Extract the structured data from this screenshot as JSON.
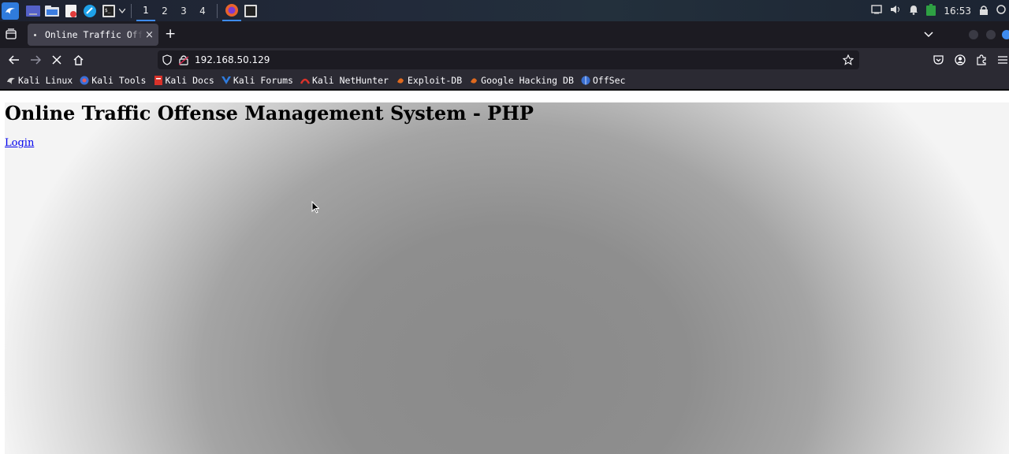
{
  "taskbar": {
    "workspaces": [
      "1",
      "2",
      "3",
      "4"
    ],
    "active_workspace": "1",
    "clock": "16:53"
  },
  "browser": {
    "tab": {
      "title": "Online Traffic Offense Management System - PHP",
      "close": "×"
    },
    "new_tab": "+",
    "url": "192.168.50.129",
    "bookmarks": [
      {
        "label": "Kali Linux",
        "icon": "kali-dragon-icon",
        "color": "#1a1a1a"
      },
      {
        "label": "Kali Tools",
        "icon": "kali-tools-icon",
        "color": "#3b6fd8"
      },
      {
        "label": "Kali Docs",
        "icon": "kali-docs-icon",
        "color": "#d9322a"
      },
      {
        "label": "Kali Forums",
        "icon": "kali-forums-icon",
        "color": "#2f7bdc"
      },
      {
        "label": "Kali NetHunter",
        "icon": "nethunter-icon",
        "color": "#d9322a"
      },
      {
        "label": "Exploit-DB",
        "icon": "exploit-db-icon",
        "color": "#e06a1e"
      },
      {
        "label": "Google Hacking DB",
        "icon": "ghdb-icon",
        "color": "#e06a1e"
      },
      {
        "label": "OffSec",
        "icon": "offsec-icon",
        "color": "#3a6fd0"
      }
    ]
  },
  "page": {
    "heading": "Online Traffic Offense Management System - PHP",
    "login_link": "Login"
  },
  "colors": {
    "accent": "#3e8cf0",
    "link": "#0000ee",
    "toolbar": "#2b2a33",
    "tabstrip": "#1c1b22"
  }
}
